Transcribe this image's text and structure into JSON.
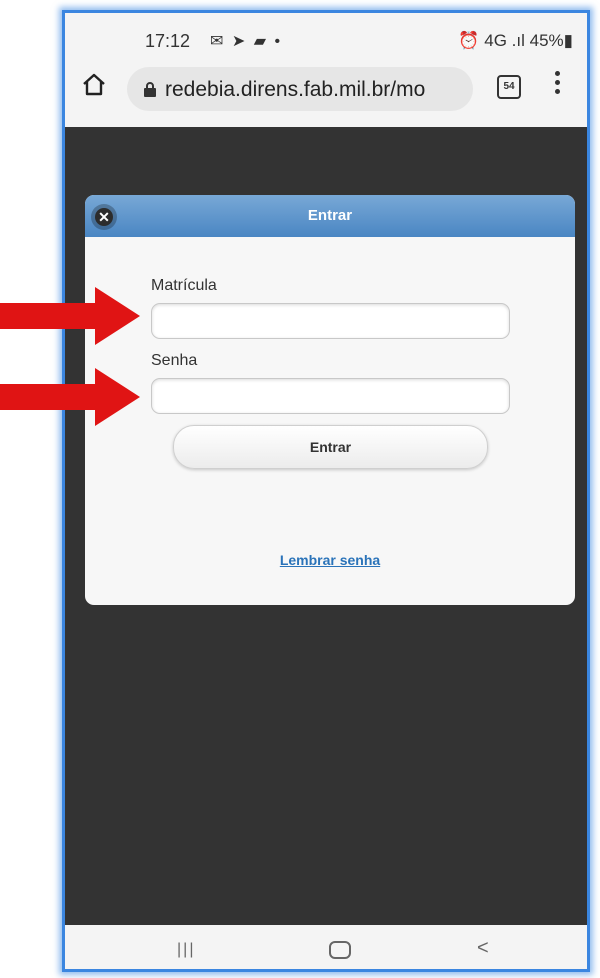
{
  "status_bar": {
    "time": "17:12",
    "icons": "✉ ➤ ▰ •",
    "right": "⏰ 4G .ıl 45%▮"
  },
  "browser": {
    "url": "redebia.direns.fab.mil.br/mo",
    "tab_count": "54"
  },
  "dialog": {
    "title": "Entrar",
    "matricula_label": "Matrícula",
    "matricula_value": "",
    "senha_label": "Senha",
    "senha_value": "",
    "submit_label": "Entrar",
    "remember_link": "Lembrar senha"
  },
  "nav": {
    "recent": "|||",
    "back": "<"
  },
  "colors": {
    "frame_border": "#3b86e0",
    "header": "#4a86c3",
    "arrow": "#e01414",
    "page_bg": "#333333"
  }
}
